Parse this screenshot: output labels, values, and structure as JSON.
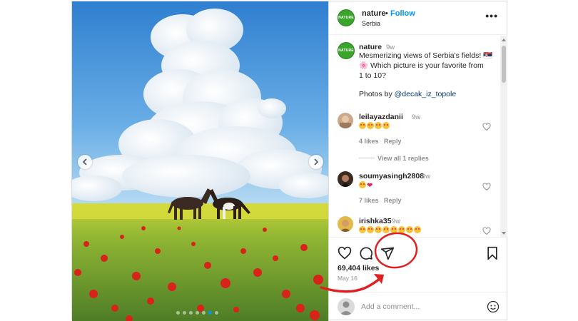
{
  "header": {
    "username": "nature",
    "separator": "•",
    "follow_label": "Follow",
    "location": "Serbia",
    "more_label": "•••",
    "logo_text": "NATURE"
  },
  "caption": {
    "username": "nature",
    "time": "9w",
    "line1": "Mesmerizing views of Serbia's fields! 🇷🇸",
    "line2": "🌸  Which picture is your favorite from",
    "line3": "1 to 10?",
    "photos_prefix": "Photos by ",
    "photos_handle": "@decak_iz_topole"
  },
  "comments": [
    {
      "username": "leilayazdanii",
      "time": "9w",
      "likes": "4 likes",
      "reply": "Reply",
      "view_replies": "View all 1 replies"
    },
    {
      "username": "soumyasingh2808",
      "time": "9w",
      "likes": "7 likes",
      "reply": "Reply"
    },
    {
      "username": "irishka35",
      "time": "9w"
    }
  ],
  "actions": {
    "likes": "69,404 likes",
    "date": "May 16"
  },
  "add_comment": {
    "placeholder": "Add a comment..."
  },
  "carousel": {
    "dot_count": 7,
    "active_index": 5
  },
  "colors": {
    "accent": "#0095f6",
    "annotation": "#e02020",
    "logo": "#3aa52b"
  },
  "icons": [
    "chevron-left-icon",
    "chevron-right-icon",
    "more-icon",
    "heart-icon",
    "comment-icon",
    "share-icon",
    "bookmark-icon",
    "emoji-icon"
  ]
}
